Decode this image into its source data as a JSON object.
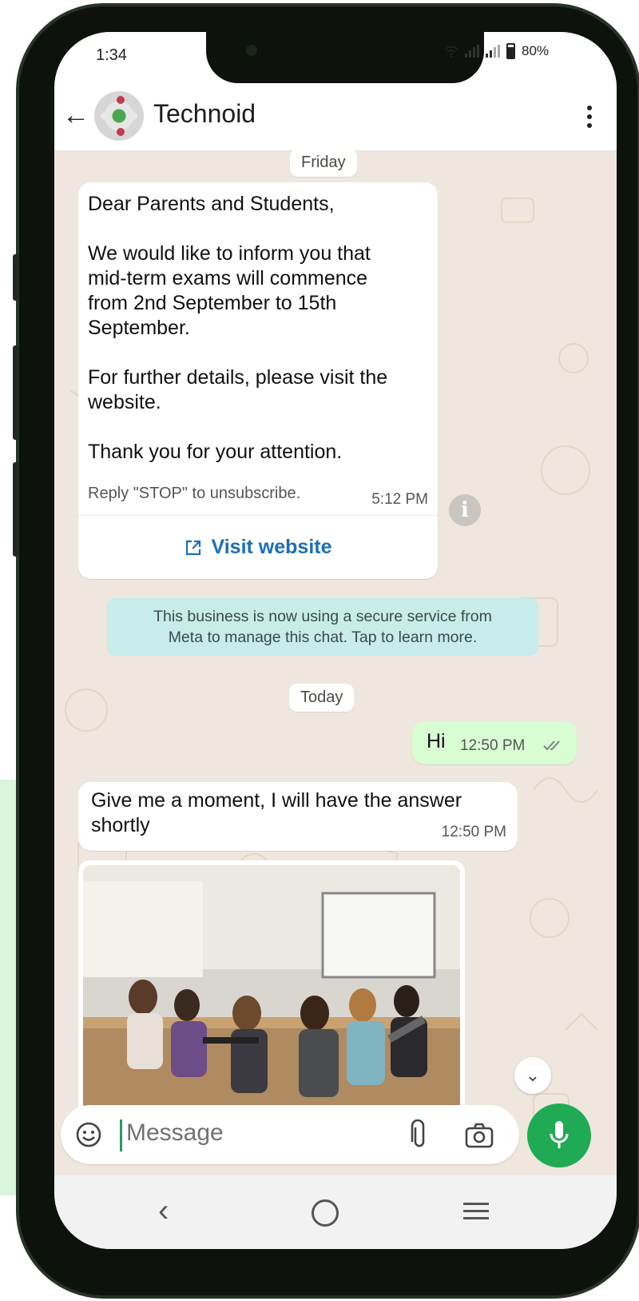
{
  "status": {
    "time": "1:34",
    "battery": "80%"
  },
  "header": {
    "title": "Technoid"
  },
  "chat": {
    "date1": "Friday",
    "message1": {
      "greeting": "Dear Parents and Students,",
      "line1": "We would like to inform you that",
      "line2": "mid-term exams will commence",
      "line3": "from 2nd September to 15th",
      "line4": "September.",
      "line5": "For further details, please visit the",
      "line6": "website.",
      "line7": "Thank you for your attention.",
      "footer": "Reply \"STOP\" to unsubscribe.",
      "time": "5:12 PM",
      "button": "Visit website"
    },
    "system_notice": {
      "line1": "This business is now using a secure service from",
      "line2": "Meta to manage this chat. Tap to learn more."
    },
    "date2": "Today",
    "outgoing": {
      "text": "Hi",
      "time": "12:50 PM"
    },
    "incoming2": {
      "line1": "Give me a moment, I will have the answer",
      "line2": "shortly",
      "time": "12:50 PM"
    }
  },
  "composer": {
    "placeholder": "Message"
  },
  "icons": [
    "back-arrow-icon",
    "more-vert-icon",
    "info-icon",
    "external-link-icon",
    "double-check-icon",
    "scroll-down-icon",
    "emoji-icon",
    "attach-icon",
    "camera-icon",
    "mic-icon",
    "nav-back-icon",
    "nav-home-icon",
    "nav-recents-icon"
  ],
  "colors": {
    "accent": "#1faa53",
    "outgoing_bubble": "#d9fdd3",
    "link": "#1b6fb5",
    "system_bg": "#c7ecea"
  }
}
